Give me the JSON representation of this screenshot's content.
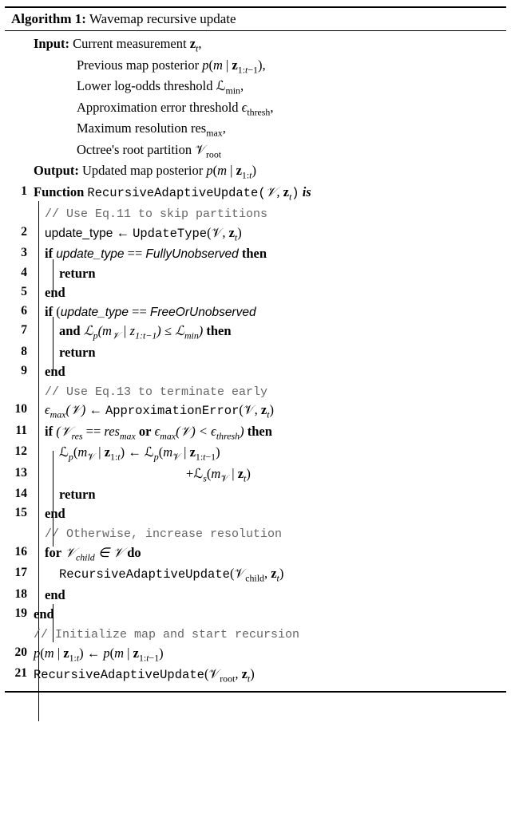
{
  "algorithm": {
    "number": "Algorithm 1:",
    "title": "Wavemap recursive update",
    "input_label": "Input:",
    "inputs": [
      "Current measurement 𝐳ₜ,",
      "Previous map posterior p(m | 𝐳₁:ₜ₋₁),",
      "Lower log-odds threshold ℒₘᵢₙ,",
      "Approximation error threshold ϵₜₕᵣₑₛₕ,",
      "Maximum resolution resₘₐₓ,",
      "Octree's root partition 𝒱ᵣₒₒₜ"
    ],
    "output_label": "Output:",
    "output": "Updated map posterior p(m | 𝐳₁:ₜ)",
    "fn_kw": "Function",
    "fn_name": "RecursiveAdaptiveUpdate",
    "fn_args": "(𝒱, 𝐳ₜ)",
    "is_kw": "is",
    "comment_skip": "// Use Eq.11 to skip partitions",
    "l2_lhs": "update_type",
    "l2_arrow": " ← ",
    "l2_rhs_fn": "UpdateType",
    "l2_rhs_args": "(𝒱, 𝐳ₜ)",
    "if_kw": "if",
    "then_kw": "then",
    "return_kw": "return",
    "end_kw": "end",
    "and_kw": "and",
    "or_kw": "or",
    "for_kw": "for",
    "in_kw": " ∈ ",
    "do_kw": "do",
    "l3_cond_a": "update_type",
    "l3_cond_b": " == ",
    "l3_cond_c": "FullyUnobserved",
    "l6_open": "(",
    "l6_a": "update_type",
    "l6_b": " == ",
    "l6_c": "FreeOrUnobserved",
    "l7_expr": "ℒₚ(m_𝒱 | z₁:ₜ₋₁) ≤ ℒ_min)",
    "comment_term": "// Use Eq.13 to terminate early",
    "l10_lhs": "ϵₘₐₓ(𝒱)",
    "l10_arrow": " ← ",
    "l10_fn": "ApproximationError",
    "l10_args": "(𝒱, 𝐳ₜ)",
    "l11_open": "(",
    "l11_a": "𝒱_res",
    "l11_b": " == ",
    "l11_c": "res_max",
    "l11_d": "ϵ_max(𝒱) < ϵ_thresh)",
    "l12": "ℒₚ(m_𝒱 | 𝐳₁:ₜ) ← ℒₚ(m_𝒱 | 𝐳₁:ₜ₋₁)",
    "l13": "+ℒₛ(m_𝒱 | 𝐳ₜ)",
    "comment_else": "// Otherwise, increase resolution",
    "l16_a": "𝒱_child",
    "l16_b": "𝒱",
    "l17_fn": "RecursiveAdaptiveUpdate",
    "l17_args": "(𝒱_child, 𝐳ₜ)",
    "comment_init": "// Initialize map and start recursion",
    "l20": "p(m | 𝐳₁:ₜ) ← p(m | 𝐳₁:ₜ₋₁)",
    "l21_fn": "RecursiveAdaptiveUpdate",
    "l21_args": "(𝒱ᵣₒₒₜ, 𝐳ₜ)"
  }
}
